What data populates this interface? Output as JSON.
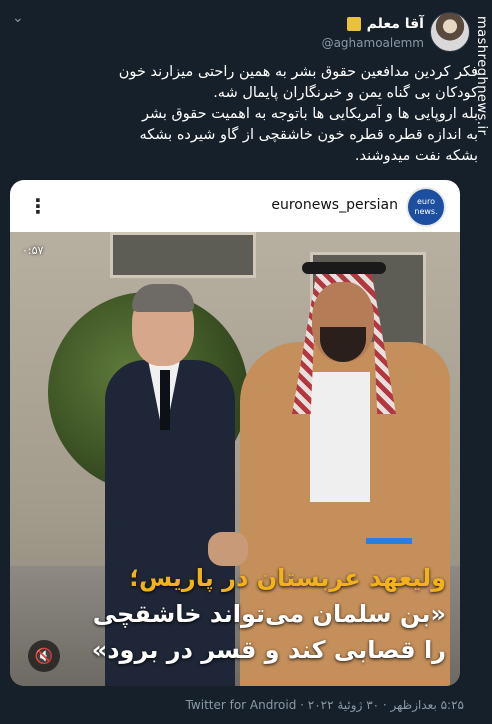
{
  "user": {
    "display_name": "آقا معلم",
    "handle": "@aghamoalemm"
  },
  "tweet": {
    "text": "فکر کردین مدافعین حقوق بشر به همین راحتی میزارند خون\nکودکان بی گناه یمن و خبرنگاران پایمال شه.\nبله اروپایی ها و آمریکایی ها باتوجه به اهمیت حقوق بشر\nبه اندازه قطره قطره خون خاشقچی از گاو شیرده بشکه\nبشکه نفت میدوشند.",
    "meta": "۵:۲۵ بعدازظهر · ۳۰ ژوئیهٔ ۲۰۲۲ · Twitter for Android"
  },
  "media": {
    "account_name": "euronews_persian",
    "logo_line1": "euro",
    "logo_line2": "news.",
    "video_time": "۰:۵۷",
    "caption_highlight": "ولیعهد عربستان در پاریس؛",
    "caption_line2": "«بن سلمان می‌تواند خاشقچی",
    "caption_line3": "را قصابی کند و قسر در برود»"
  },
  "watermark": "mashreghnews.ir",
  "icons": {
    "more": "more-icon",
    "mute": "speaker-muted-icon",
    "dots": "vertical-dots-icon"
  },
  "colors": {
    "background": "#15202b",
    "caption_highlight": "#f2b21b",
    "accent_bar": "#2b7de3"
  }
}
